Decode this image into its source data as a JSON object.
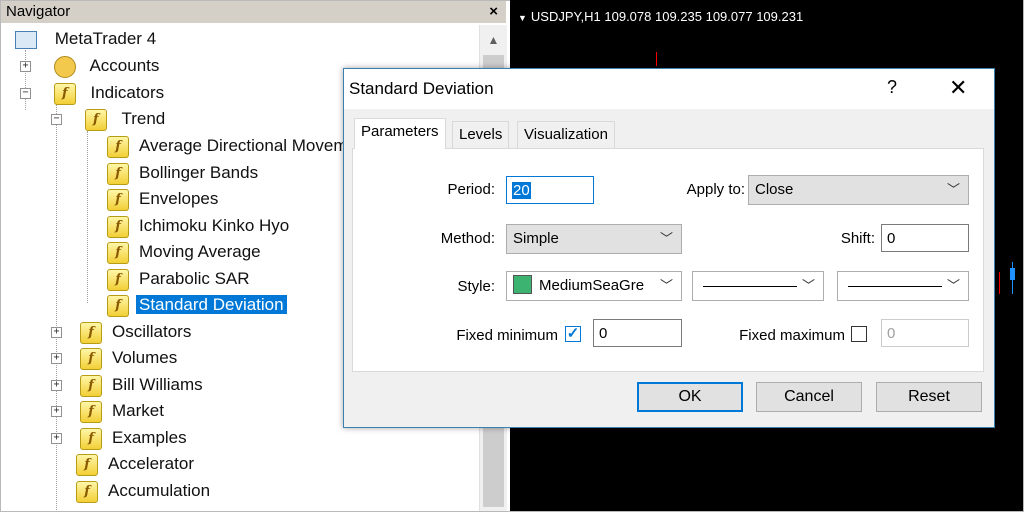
{
  "navigator": {
    "title": "Navigator",
    "close_label": "×",
    "tree": {
      "root": "MetaTrader 4",
      "accounts": "Accounts",
      "indicators": "Indicators",
      "trend": "Trend",
      "trend_items": [
        "Average Directional Movement Index",
        "Bollinger Bands",
        "Envelopes",
        "Ichimoku Kinko Hyo",
        "Moving Average",
        "Parabolic SAR",
        "Standard Deviation"
      ],
      "groups": [
        "Oscillators",
        "Volumes",
        "Bill Williams",
        "Market",
        "Examples",
        "Accelerator",
        "Accumulation"
      ]
    },
    "selected_item": "Standard Deviation"
  },
  "chart": {
    "symbol_line": "USDJPY,H1  109.078 109.235 109.077 109.231",
    "up_color": "#ff0000",
    "down_color": "#1e90ff"
  },
  "dialog": {
    "title": "Standard Deviation",
    "help_label": "?",
    "close_label": "✕",
    "tabs": [
      "Parameters",
      "Levels",
      "Visualization"
    ],
    "active_tab": "Parameters",
    "period_label": "Period:",
    "period_value": "20",
    "apply_to_label": "Apply to:",
    "apply_to_value": "Close",
    "method_label": "Method:",
    "method_value": "Simple",
    "shift_label": "Shift:",
    "shift_value": "0",
    "style_label": "Style:",
    "style_color_name": "MediumSeaGre",
    "style_color": "#3cb371",
    "fixed_min_label": "Fixed minimum",
    "fixed_min_checked": true,
    "fixed_min_value": "0",
    "fixed_max_label": "Fixed maximum",
    "fixed_max_checked": false,
    "fixed_max_value": "0",
    "buttons": {
      "ok": "OK",
      "cancel": "Cancel",
      "reset": "Reset"
    }
  }
}
